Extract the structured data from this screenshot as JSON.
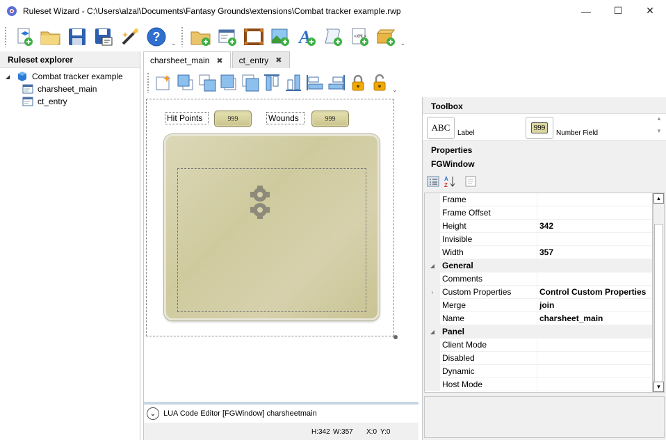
{
  "window": {
    "title": "Ruleset Wizard - C:\\Users\\alzal\\Documents\\Fantasy Grounds\\extensions\\Combat tracker example.rwp",
    "minimize_glyph": "—",
    "maximize_glyph": "☐",
    "close_glyph": "✕"
  },
  "toolbar": {
    "items": [
      "new-project-icon",
      "open-folder-icon",
      "save-icon",
      "save-as-icon",
      "wizard-wand-icon",
      "help-icon",
      "add-folder-icon",
      "add-window-icon",
      "add-frame-icon",
      "add-image-icon",
      "add-font-icon",
      "add-script-icon",
      "add-xml-icon",
      "add-package-icon"
    ],
    "overflow_glyph": "⌄"
  },
  "explorer": {
    "header": "Ruleset explorer",
    "project": "Combat tracker example",
    "items": [
      "charsheet_main",
      "ct_entry"
    ]
  },
  "tabs": [
    {
      "label": "charsheet_main",
      "close": "✖"
    },
    {
      "label": "ct_entry",
      "close": "✖"
    }
  ],
  "canvas": {
    "label1": "Hit Points",
    "field1": "999",
    "label2": "Wounds",
    "field2": "999"
  },
  "lua": {
    "toggle": "⌄",
    "label": "LUA Code Editor [FGWindow] charsheetmain"
  },
  "status": {
    "height": "H:342",
    "width": "W:357",
    "x": "X:0",
    "y": "Y:0"
  },
  "toolbox": {
    "header": "Toolbox",
    "items": [
      {
        "glyph": "ABC",
        "label": "Label"
      },
      {
        "glyph": "999",
        "label": "Number Field"
      }
    ]
  },
  "properties": {
    "header": "Properties",
    "object": "FGWindow",
    "rows": [
      {
        "name": "Frame",
        "value": ""
      },
      {
        "name": "Frame Offset",
        "value": ""
      },
      {
        "name": "Height",
        "value": "342"
      },
      {
        "name": "Invisible",
        "value": ""
      },
      {
        "name": "Width",
        "value": "357"
      }
    ],
    "cat_general": "General",
    "general_rows": [
      {
        "name": "Comments",
        "value": ""
      },
      {
        "name": "Custom Properties",
        "value": "Control Custom Properties"
      },
      {
        "name": "Merge",
        "value": "join"
      },
      {
        "name": "Name",
        "value": "charsheet_main"
      }
    ],
    "cat_panel": "Panel",
    "panel_rows": [
      {
        "name": "Client Mode",
        "value": ""
      },
      {
        "name": "Disabled",
        "value": ""
      },
      {
        "name": "Dynamic",
        "value": ""
      },
      {
        "name": "Host Mode",
        "value": ""
      }
    ]
  }
}
